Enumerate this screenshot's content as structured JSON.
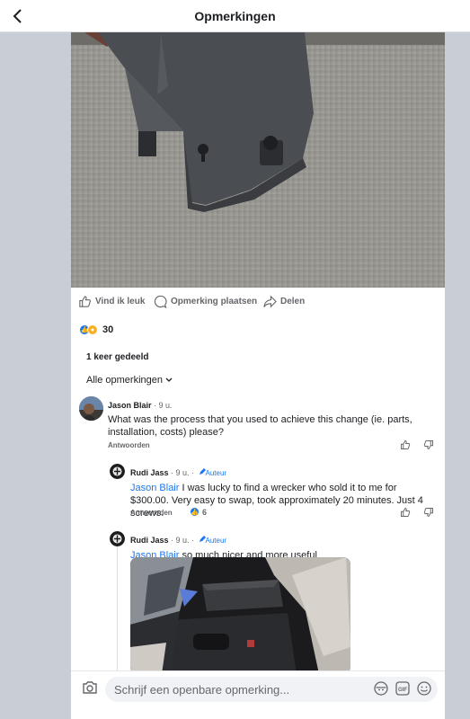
{
  "header": {
    "title": "Opmerkingen"
  },
  "post_actions": {
    "like": "Vind ik leuk",
    "comment": "Opmerking plaatsen",
    "share": "Delen"
  },
  "reactions": {
    "count": "30"
  },
  "shares": "1 keer gedeeld",
  "sort": {
    "label": "Alle opmerkingen"
  },
  "comments": [
    {
      "author": "Jason Blair",
      "meta": " · 9 u.",
      "text": "What was the process that you used to achieve this change (ie. parts, installation, costs) please?",
      "reply_label": "Antwoorden"
    },
    {
      "author": "Rudi Jass",
      "meta": " · 9 u. ·",
      "badge": "Auteur",
      "mention": "Jason Blair",
      "text": " I was lucky to find a wrecker who sold it to me for $300.00. Very easy to swap, took approximately 20 minutes. Just 4 screws.",
      "reply_label": "Antwoorden",
      "reaction_count": "6"
    },
    {
      "author": "Rudi Jass",
      "meta": " · 9 u. ·",
      "badge": "Auteur",
      "mention": "Jason Blair",
      "text": " so much nicer and more useful"
    }
  ],
  "composer": {
    "placeholder": "Schrijf een openbare opmerking..."
  }
}
